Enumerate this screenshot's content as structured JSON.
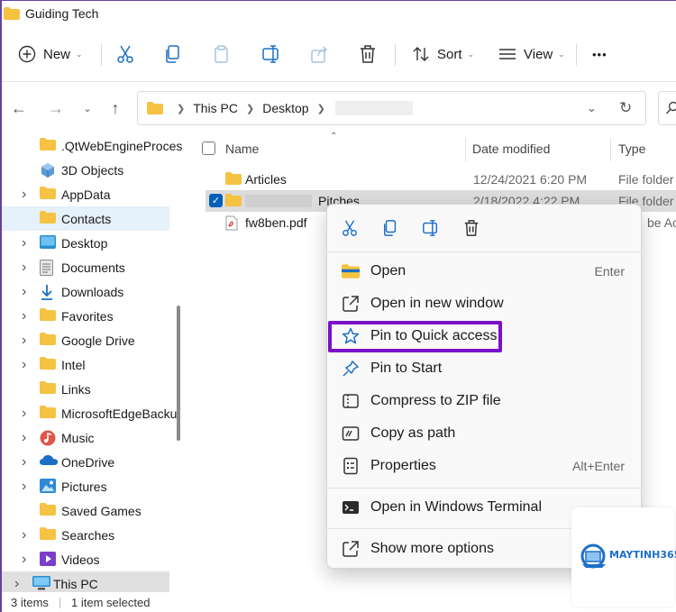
{
  "window": {
    "title": "Guiding Tech"
  },
  "toolbar": {
    "new_label": "New",
    "sort_label": "Sort",
    "view_label": "View",
    "more_label": "•••"
  },
  "address": {
    "crumbs": [
      "This PC",
      "Desktop"
    ]
  },
  "sidebar": {
    "items": [
      {
        "label": ".QtWebEngineProces",
        "icon": "folder-icon",
        "expandable": false
      },
      {
        "label": "3D Objects",
        "icon": "3d-objects-icon",
        "expandable": false
      },
      {
        "label": "AppData",
        "icon": "folder-icon",
        "expandable": true
      },
      {
        "label": "Contacts",
        "icon": "folder-icon",
        "expandable": false
      },
      {
        "label": "Desktop",
        "icon": "desktop-icon",
        "expandable": true
      },
      {
        "label": "Documents",
        "icon": "documents-icon",
        "expandable": true
      },
      {
        "label": "Downloads",
        "icon": "downloads-icon",
        "expandable": true
      },
      {
        "label": "Favorites",
        "icon": "folder-icon",
        "expandable": true
      },
      {
        "label": "Google Drive",
        "icon": "folder-icon",
        "expandable": true
      },
      {
        "label": "Intel",
        "icon": "folder-icon",
        "expandable": true
      },
      {
        "label": "Links",
        "icon": "folder-icon",
        "expandable": false
      },
      {
        "label": "MicrosoftEdgeBacku",
        "icon": "folder-icon",
        "expandable": true
      },
      {
        "label": "Music",
        "icon": "music-icon",
        "expandable": true
      },
      {
        "label": "OneDrive",
        "icon": "onedrive-icon",
        "expandable": true
      },
      {
        "label": "Pictures",
        "icon": "pictures-icon",
        "expandable": true
      },
      {
        "label": "Saved Games",
        "icon": "folder-icon",
        "expandable": false
      },
      {
        "label": "Searches",
        "icon": "folder-icon",
        "expandable": true
      },
      {
        "label": "Videos",
        "icon": "videos-icon",
        "expandable": true
      },
      {
        "label": "This PC",
        "icon": "this-pc-icon",
        "expandable": true
      }
    ]
  },
  "columns": {
    "name": "Name",
    "date": "Date modified",
    "type": "Type"
  },
  "files": [
    {
      "name": "Articles",
      "date": "12/24/2021 6:20 PM",
      "type": "File folder",
      "icon": "folder-icon"
    },
    {
      "name": "Pitches",
      "date": "2/18/2022 4:22 PM",
      "type": "File folder",
      "icon": "folder-icon"
    },
    {
      "name": "fw8ben.pdf",
      "date": "",
      "type": "be Acro",
      "icon": "pdf-icon"
    }
  ],
  "context_menu": {
    "items": [
      {
        "label": "Open",
        "shortcut": "Enter",
        "icon": "folder-open-icon"
      },
      {
        "label": "Open in new window",
        "shortcut": "",
        "icon": "open-new-window-icon"
      },
      {
        "label": "Pin to Quick access",
        "shortcut": "",
        "icon": "star-icon"
      },
      {
        "label": "Pin to Start",
        "shortcut": "",
        "icon": "pin-icon"
      },
      {
        "label": "Compress to ZIP file",
        "shortcut": "",
        "icon": "zip-icon"
      },
      {
        "label": "Copy as path",
        "shortcut": "",
        "icon": "copy-path-icon"
      },
      {
        "label": "Properties",
        "shortcut": "Alt+Enter",
        "icon": "properties-icon"
      },
      {
        "label": "Open in Windows Terminal",
        "shortcut": "",
        "icon": "terminal-icon"
      },
      {
        "label": "Show more options",
        "shortcut": "",
        "icon": "show-more-icon"
      }
    ]
  },
  "status": {
    "items": "3 items",
    "selected": "1 item selected"
  },
  "watermark": {
    "brand": "MAYTINH365"
  },
  "colors": {
    "highlight": "#7a11c9",
    "accent": "#005fb8",
    "folder": "#f5c242"
  }
}
